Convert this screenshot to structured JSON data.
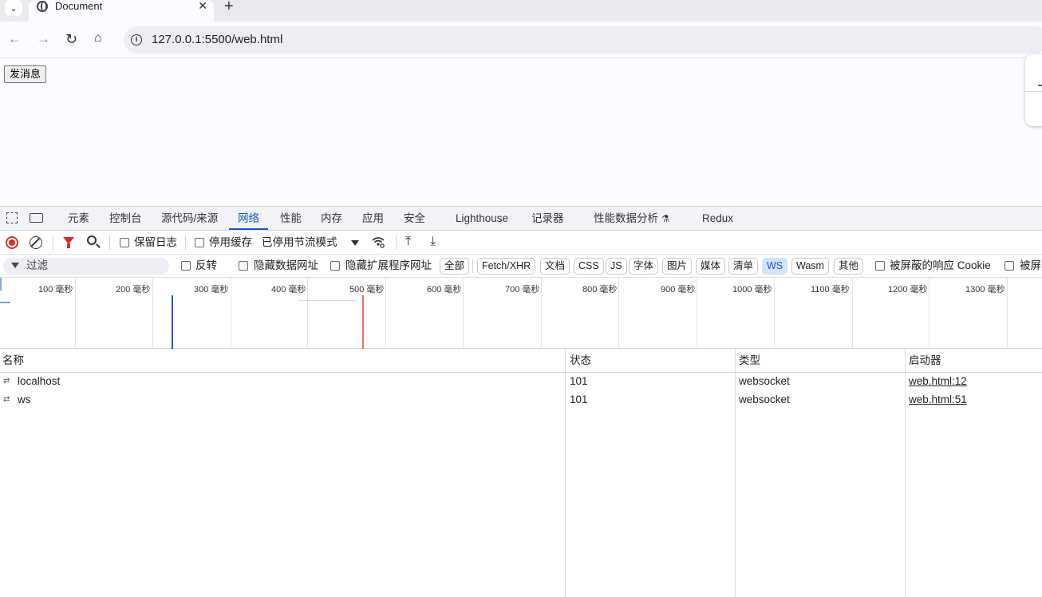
{
  "browser": {
    "tab_title": "Document",
    "url": "127.0.0.1:5500/web.html"
  },
  "page": {
    "button_label": "发消息"
  },
  "devtools": {
    "tabs": [
      "元素",
      "控制台",
      "源代码/来源",
      "网络",
      "性能",
      "内存",
      "应用",
      "安全",
      "Lighthouse",
      "记录器",
      "性能数据分析",
      "Redux"
    ],
    "active_tab": "网络",
    "toolbar": {
      "preserve_log": "保留日志",
      "disable_cache": "停用缓存",
      "throttling": "已停用节流模式"
    },
    "filter": {
      "placeholder": "过滤",
      "invert": "反转",
      "hide_data_urls": "隐藏数据网址",
      "hide_extension_urls": "隐藏扩展程序网址",
      "types": [
        "全部",
        "Fetch/XHR",
        "文档",
        "CSS",
        "JS",
        "字体",
        "图片",
        "媒体",
        "清单",
        "WS",
        "Wasm",
        "其他"
      ],
      "active_type": "WS",
      "blocked_cookies": "被屏蔽的响应 Cookie",
      "blocked_requests": "被屏"
    },
    "timeline": {
      "ticks": [
        "100 毫秒",
        "200 毫秒",
        "300 毫秒",
        "400 毫秒",
        "500 毫秒",
        "600 毫秒",
        "700 毫秒",
        "800 毫秒",
        "900 毫秒",
        "1000 毫秒",
        "1100 毫秒",
        "1200 毫秒",
        "1300 毫秒"
      ]
    },
    "table": {
      "columns": [
        "名称",
        "状态",
        "类型",
        "启动器"
      ],
      "rows": [
        {
          "name": "localhost",
          "status": "101",
          "type": "websocket",
          "initiator": "web.html:12"
        },
        {
          "name": "ws",
          "status": "101",
          "type": "websocket",
          "initiator": "web.html:51"
        }
      ]
    }
  }
}
